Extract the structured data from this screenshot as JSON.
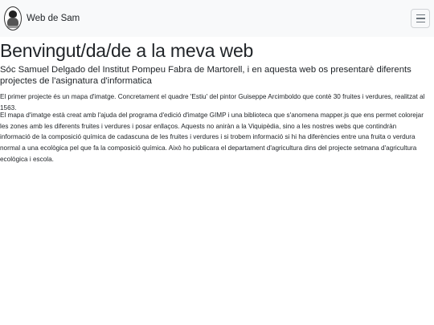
{
  "navbar": {
    "brand_text": "Web de Sam",
    "logo_icon": "person-portrait-icon",
    "menu_icon": "hamburger-menu-icon"
  },
  "main": {
    "title": "Benvingut/da/de a la meva web",
    "subtitle": "Sóc Samuel Delgado del Institut Pompeu Fabra de Martorell, i en aquesta web os presentarè diferents projectes de l'asignatura d'informatica",
    "paragraph_1": "El primer projecte és un mapa d'imatge. Concretament el quadre 'Estiu' del pintor Guiseppe Arcimboldo que contè 30 fruites i verdures, realitzat al 1563.",
    "paragraph_2": "El mapa d'imatge està creat amb l'ajuda del programa d'edició d'imatge GIMP i una biblioteca que s'anomena mapper.js que ens permet colorejar les zones amb les diferents fruites i verdures i posar enllaços. Aquests no aniràn a la Viquipèdia, sino a les nostres webs que contindràn informació de la composició química de cadascuna de les fruites i verdures i si trobem informació si hi ha diferències entre una fruita o verdura normal a una ecològica pel que fa la composició química. Això ho publicara el departament d'agricultura dins del projecte setmana d'agricultura ecològica i escola."
  }
}
